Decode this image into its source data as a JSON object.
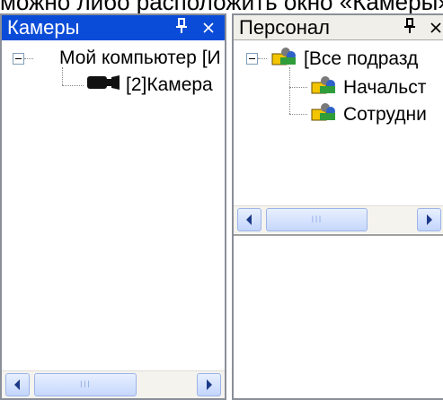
{
  "doc_text": "можно либо расположить окно «Камеры»",
  "cameras_panel": {
    "title": "Камеры",
    "pin_icon": "pin-icon",
    "close_icon": "close-icon",
    "tree": [
      {
        "label": "Мой компьютер [И",
        "icon": "minus-expander-icon"
      },
      {
        "label": "[2]Камера",
        "icon": "camera-icon"
      }
    ]
  },
  "personnel_panel": {
    "title": "Персонал",
    "pin_icon": "pin-icon",
    "close_icon": "close-icon",
    "tree": [
      {
        "label": "[Все подразд",
        "icon": "people-group-icon"
      },
      {
        "label": "Начальст",
        "icon": "people-group-icon"
      },
      {
        "label": "Сотрудни",
        "icon": "people-group-icon"
      }
    ]
  },
  "scroll_grip": "III",
  "colors": {
    "active_title": "#0a4cd8",
    "inactive_title": "#f0efe9"
  }
}
